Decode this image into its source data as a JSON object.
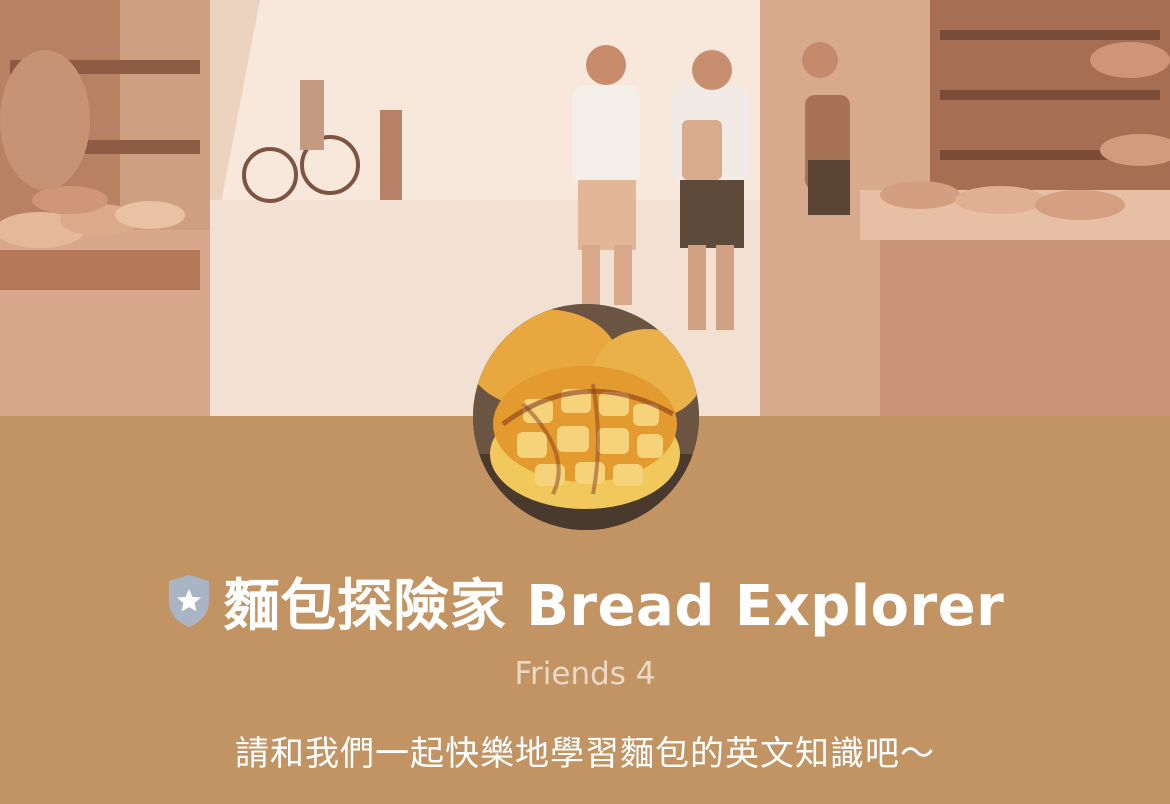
{
  "profile": {
    "name": "麵包探險家 Bread Explorer",
    "friends_label": "Friends 4",
    "status_message": "請和我們一起快樂地學習麵包的英文知識吧～"
  },
  "images": {
    "cover": "bakery-street-scene",
    "avatar": "pineapple-bun-photo"
  },
  "icons": {
    "badge": "verified-shield-star-icon"
  },
  "colors": {
    "profile_background": "#c29464",
    "title_text": "#ffffff",
    "friends_text": "#ead9c6",
    "badge": "#a9b4c4"
  }
}
